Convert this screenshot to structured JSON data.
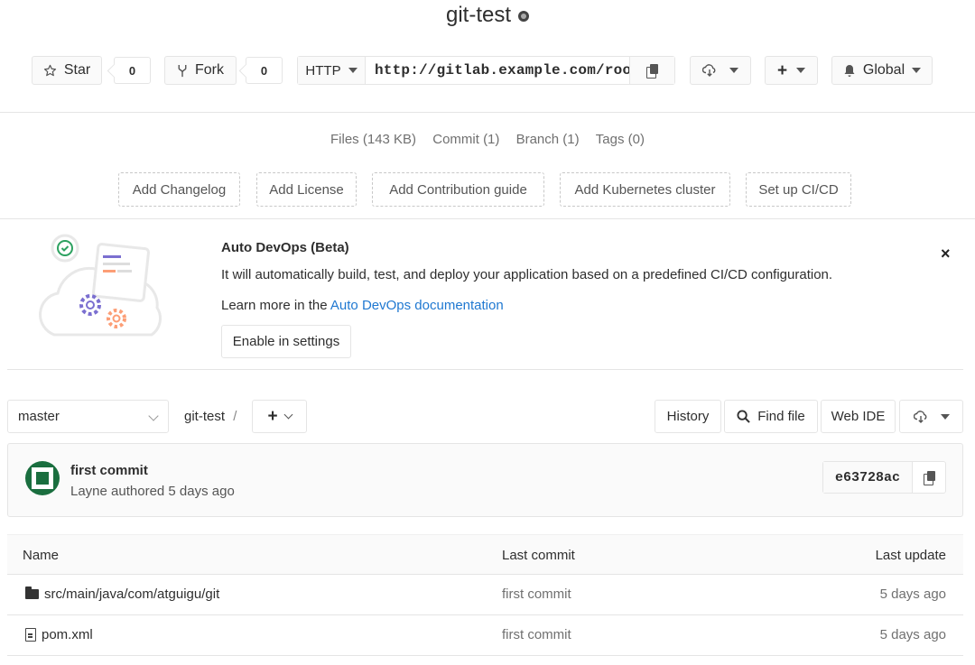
{
  "project": {
    "name": "git-test",
    "visibility_icon": "globe-icon"
  },
  "actions": {
    "star_label": "Star",
    "star_count": "0",
    "fork_label": "Fork",
    "fork_count": "0",
    "clone_protocol": "HTTP",
    "clone_url": "http://gitlab.example.com/roo",
    "notification_label": "Global"
  },
  "stats": {
    "files": "Files (143 KB)",
    "commits": "Commit (1)",
    "branches": "Branch (1)",
    "tags": "Tags (0)"
  },
  "quick_actions": [
    "Add Changelog",
    "Add License",
    "Add Contribution guide",
    "Add Kubernetes cluster",
    "Set up CI/CD"
  ],
  "auto_devops": {
    "title": "Auto DevOps (Beta)",
    "description": "It will automatically build, test, and deploy your application based on a predefined CI/CD configuration.",
    "learn_prefix": "Learn more in the",
    "learn_link": "Auto DevOps documentation",
    "enable_button": "Enable in settings",
    "close": "×"
  },
  "repo_nav": {
    "branch": "master",
    "breadcrumb": "git-test",
    "breadcrumb_sep": "/",
    "add_button": "+",
    "history": "History",
    "find_file": "Find file",
    "web_ide": "Web IDE"
  },
  "last_commit": {
    "title": "first commit",
    "author_meta": "Layne authored 5 days ago",
    "sha": "e63728ac"
  },
  "file_table": {
    "headers": {
      "name": "Name",
      "last_commit": "Last commit",
      "last_update": "Last update"
    },
    "rows": [
      {
        "type": "folder",
        "name": "src/main/java/com/atguigu/git",
        "last_commit": "first commit",
        "last_update": "5 days ago"
      },
      {
        "type": "file",
        "name": "pom.xml",
        "last_commit": "first commit",
        "last_update": "5 days ago"
      }
    ]
  }
}
